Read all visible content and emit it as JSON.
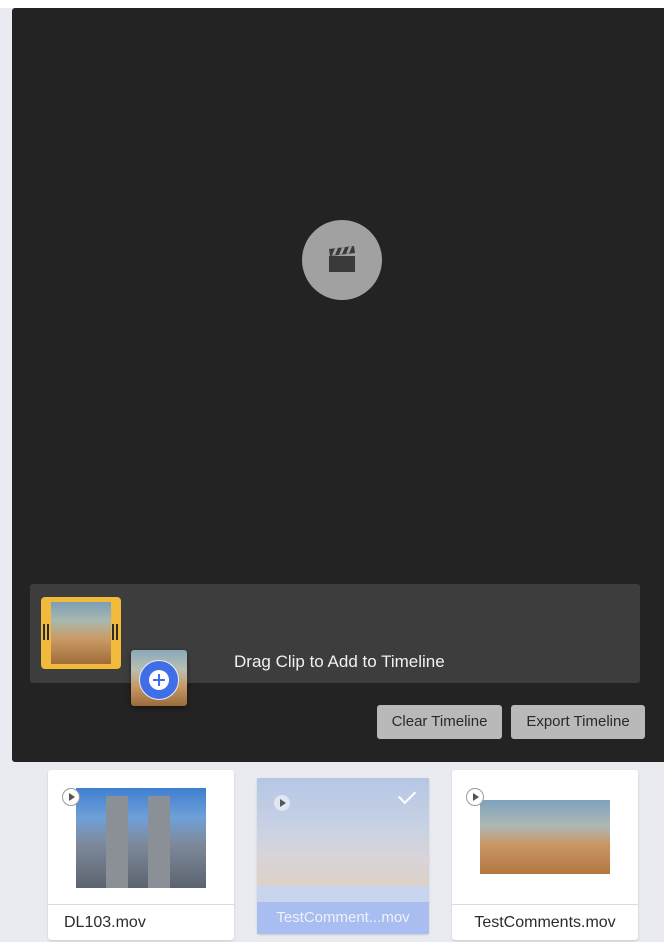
{
  "player": {
    "center_icon": "clapperboard-icon"
  },
  "timeline": {
    "hint": "Drag Clip to Add to Timeline",
    "clip_color": "#f2ba3b",
    "add_icon": "plus-circle-icon",
    "add_color": "#3f6ee6"
  },
  "actions": {
    "clear_label": "Clear Timeline",
    "export_label": "Export Timeline"
  },
  "library": {
    "clips": [
      {
        "name": "DL103.mov",
        "selected": false
      },
      {
        "name": "TestComment...mov",
        "selected": true
      },
      {
        "name": "TestComments.mov",
        "selected": false
      }
    ]
  }
}
